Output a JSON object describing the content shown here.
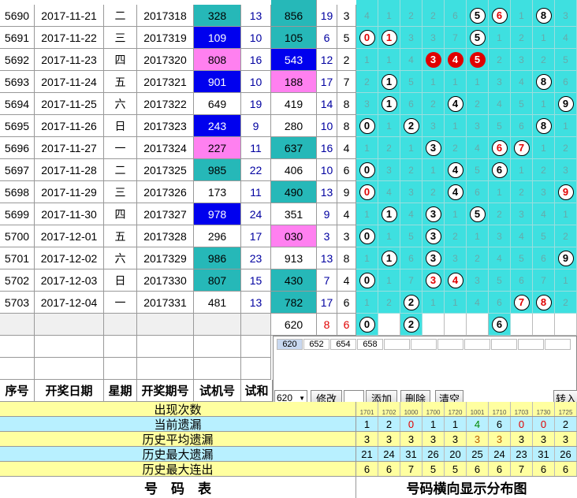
{
  "rows": [
    {
      "seq": "5690",
      "date": "2017-11-21",
      "wd": "二",
      "period": "2017318",
      "trial": "328",
      "trial_c": "teal",
      "sum1": "13",
      "win": "856",
      "win_c": "teal",
      "sum2": "19",
      "span": "3",
      "grid": [
        "4",
        "1",
        "2",
        "2",
        "6",
        "W5",
        "WR6",
        "1",
        "W8",
        "3"
      ]
    },
    {
      "seq": "5691",
      "date": "2017-11-22",
      "wd": "三",
      "period": "2017319",
      "trial": "109",
      "trial_c": "blue",
      "sum1": "10",
      "win": "105",
      "win_c": "teal",
      "sum2": "6",
      "span": "5",
      "grid": [
        "WR0",
        "WR1",
        "3",
        "3",
        "7",
        "W5",
        "1",
        "2",
        "1",
        "4"
      ]
    },
    {
      "seq": "5692",
      "date": "2017-11-23",
      "wd": "四",
      "period": "2017320",
      "trial": "808",
      "trial_c": "pink",
      "sum1": "16",
      "win": "543",
      "win_c": "blue",
      "sum2": "12",
      "span": "2",
      "grid": [
        "1",
        "1",
        "4",
        "R3",
        "R4",
        "R5",
        "2",
        "3",
        "2",
        "5"
      ]
    },
    {
      "seq": "5693",
      "date": "2017-11-24",
      "wd": "五",
      "period": "2017321",
      "trial": "901",
      "trial_c": "blue",
      "sum1": "10",
      "win": "188",
      "win_c": "pink",
      "sum2": "17",
      "span": "7",
      "grid": [
        "2",
        "W1",
        "5",
        "1",
        "1",
        "1",
        "3",
        "4",
        "W8",
        "6"
      ]
    },
    {
      "seq": "5694",
      "date": "2017-11-25",
      "wd": "六",
      "period": "2017322",
      "trial": "649",
      "trial_c": "white",
      "sum1": "19",
      "win": "419",
      "win_c": "white",
      "sum2": "14",
      "span": "8",
      "grid": [
        "3",
        "W1",
        "6",
        "2",
        "W4",
        "2",
        "4",
        "5",
        "1",
        "W9"
      ]
    },
    {
      "seq": "5695",
      "date": "2017-11-26",
      "wd": "日",
      "period": "2017323",
      "trial": "243",
      "trial_c": "blue",
      "sum1": "9",
      "win": "280",
      "win_c": "white",
      "sum2": "10",
      "span": "8",
      "grid": [
        "W0",
        "1",
        "W2",
        "3",
        "1",
        "3",
        "5",
        "6",
        "W8",
        "1"
      ]
    },
    {
      "seq": "5696",
      "date": "2017-11-27",
      "wd": "一",
      "period": "2017324",
      "trial": "227",
      "trial_c": "pink",
      "sum1": "11",
      "win": "637",
      "win_c": "teal",
      "sum2": "16",
      "span": "4",
      "grid": [
        "1",
        "2",
        "1",
        "W3",
        "2",
        "4",
        "WR6",
        "WR7",
        "1",
        "2"
      ]
    },
    {
      "seq": "5697",
      "date": "2017-11-28",
      "wd": "二",
      "period": "2017325",
      "trial": "985",
      "trial_c": "teal",
      "sum1": "22",
      "win": "406",
      "win_c": "white",
      "sum2": "10",
      "span": "6",
      "grid": [
        "W0",
        "3",
        "2",
        "1",
        "W4",
        "5",
        "W6",
        "1",
        "2",
        "3"
      ]
    },
    {
      "seq": "5698",
      "date": "2017-11-29",
      "wd": "三",
      "period": "2017326",
      "trial": "173",
      "trial_c": "white",
      "sum1": "11",
      "win": "490",
      "win_c": "teal",
      "sum2": "13",
      "span": "9",
      "grid": [
        "WR0",
        "4",
        "3",
        "2",
        "W4",
        "6",
        "1",
        "2",
        "3",
        "WR9"
      ]
    },
    {
      "seq": "5699",
      "date": "2017-11-30",
      "wd": "四",
      "period": "2017327",
      "trial": "978",
      "trial_c": "blue",
      "sum1": "24",
      "win": "351",
      "win_c": "white",
      "sum2": "9",
      "span": "4",
      "grid": [
        "1",
        "W1",
        "4",
        "W3",
        "1",
        "W5",
        "2",
        "3",
        "4",
        "1"
      ]
    },
    {
      "seq": "5700",
      "date": "2017-12-01",
      "wd": "五",
      "period": "2017328",
      "trial": "296",
      "trial_c": "white",
      "sum1": "17",
      "win": "030",
      "win_c": "pink",
      "sum2": "3",
      "span": "3",
      "grid": [
        "W0",
        "1",
        "5",
        "W3",
        "2",
        "1",
        "3",
        "4",
        "5",
        "2"
      ]
    },
    {
      "seq": "5701",
      "date": "2017-12-02",
      "wd": "六",
      "period": "2017329",
      "trial": "986",
      "trial_c": "teal",
      "sum1": "23",
      "win": "913",
      "win_c": "white",
      "sum2": "13",
      "span": "8",
      "grid": [
        "1",
        "W1",
        "6",
        "W3",
        "3",
        "2",
        "4",
        "5",
        "6",
        "W9"
      ]
    },
    {
      "seq": "5702",
      "date": "2017-12-03",
      "wd": "日",
      "period": "2017330",
      "trial": "807",
      "trial_c": "teal",
      "sum1": "15",
      "win": "430",
      "win_c": "teal",
      "sum2": "7",
      "span": "4",
      "grid": [
        "W0",
        "1",
        "7",
        "WR3",
        "WR4",
        "3",
        "5",
        "6",
        "7",
        "1"
      ]
    },
    {
      "seq": "5703",
      "date": "2017-12-04",
      "wd": "一",
      "period": "2017331",
      "trial": "481",
      "trial_c": "white",
      "sum1": "13",
      "win": "782",
      "win_c": "teal",
      "sum2": "17",
      "span": "6",
      "grid": [
        "1",
        "2",
        "W2",
        "1",
        "1",
        "4",
        "6",
        "WR7",
        "WR8",
        "2"
      ]
    }
  ],
  "pending": {
    "win": "620",
    "sum2": "8",
    "span": "6",
    "grid": [
      "W0",
      "",
      "W2",
      "",
      "",
      "",
      "W6",
      "",
      "",
      ""
    ]
  },
  "headers": {
    "seq": "序号",
    "date": "开奖日期",
    "wd": "星期",
    "period": "开奖期号",
    "trial": "试机号",
    "sum": "试和"
  },
  "panel": {
    "tabs": [
      "620",
      "652",
      "654",
      "658"
    ],
    "select": "620",
    "buttons": {
      "modify": "修改",
      "add": "添加",
      "delete": "删除",
      "clear": "清空",
      "transfer": "转入"
    }
  },
  "stats": {
    "col_codes": [
      "1701",
      "1702",
      "1000",
      "1700",
      "1720",
      "1001",
      "1710",
      "1703",
      "1730",
      "1725"
    ],
    "rows": [
      {
        "label": "出现次数",
        "values": []
      },
      {
        "label": "当前遗漏",
        "values": [
          "1",
          "2",
          "0",
          "1",
          "1",
          "4",
          "6",
          "0",
          "0",
          "2"
        ]
      },
      {
        "label": "历史平均遗漏",
        "values": [
          "3",
          "3",
          "3",
          "3",
          "3",
          "3",
          "3",
          "3",
          "3",
          "3"
        ]
      },
      {
        "label": "历史最大遗漏",
        "values": [
          "21",
          "24",
          "31",
          "26",
          "20",
          "25",
          "24",
          "23",
          "31",
          "26"
        ]
      },
      {
        "label": "历史最大连出",
        "values": [
          "6",
          "6",
          "7",
          "5",
          "5",
          "6",
          "6",
          "7",
          "6",
          "6"
        ]
      }
    ]
  },
  "footer": {
    "left": "号　码　表",
    "right": "号码横向显示分布图"
  },
  "colors": {
    "teal": "#26b8b8",
    "blue": "#0000ee",
    "pink": "#ff80f0",
    "grid": "#3ee0e0",
    "red": "#e00000"
  }
}
